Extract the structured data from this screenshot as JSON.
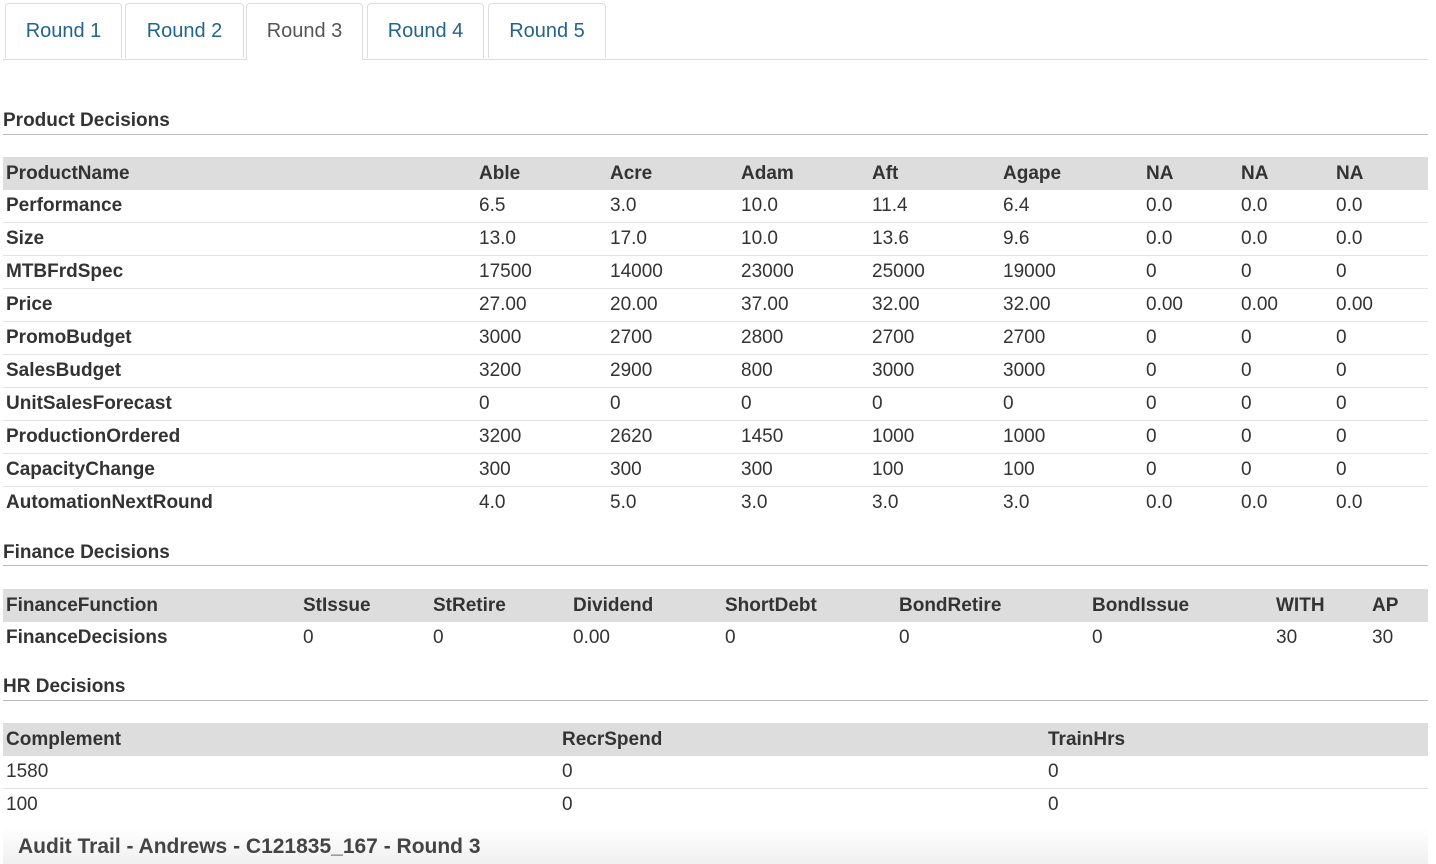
{
  "tabs": [
    "Round 1",
    "Round 2",
    "Round 3",
    "Round 4",
    "Round 5"
  ],
  "active_tab": "Round 3",
  "product": {
    "title": "Product Decisions",
    "headers": [
      "ProductName",
      "Able",
      "Acre",
      "Adam",
      "Aft",
      "Agape",
      "NA",
      "NA",
      "NA"
    ],
    "rows": [
      [
        "Performance",
        "6.5",
        "3.0",
        "10.0",
        "11.4",
        "6.4",
        "0.0",
        "0.0",
        "0.0"
      ],
      [
        "Size",
        "13.0",
        "17.0",
        "10.0",
        "13.6",
        "9.6",
        "0.0",
        "0.0",
        "0.0"
      ],
      [
        "MTBFrdSpec",
        "17500",
        "14000",
        "23000",
        "25000",
        "19000",
        "0",
        "0",
        "0"
      ],
      [
        "Price",
        "27.00",
        "20.00",
        "37.00",
        "32.00",
        "32.00",
        "0.00",
        "0.00",
        "0.00"
      ],
      [
        "PromoBudget",
        "3000",
        "2700",
        "2800",
        "2700",
        "2700",
        "0",
        "0",
        "0"
      ],
      [
        "SalesBudget",
        "3200",
        "2900",
        "800",
        "3000",
        "3000",
        "0",
        "0",
        "0"
      ],
      [
        "UnitSalesForecast",
        "0",
        "0",
        "0",
        "0",
        "0",
        "0",
        "0",
        "0"
      ],
      [
        "ProductionOrdered",
        "3200",
        "2620",
        "1450",
        "1000",
        "1000",
        "0",
        "0",
        "0"
      ],
      [
        "CapacityChange",
        "300",
        "300",
        "300",
        "100",
        "100",
        "0",
        "0",
        "0"
      ],
      [
        "AutomationNextRound",
        "4.0",
        "5.0",
        "3.0",
        "3.0",
        "3.0",
        "0.0",
        "0.0",
        "0.0"
      ]
    ]
  },
  "finance": {
    "title": "Finance Decisions",
    "headers": [
      "FinanceFunction",
      "StIssue",
      "StRetire",
      "Dividend",
      "ShortDebt",
      "BondRetire",
      "BondIssue",
      "WITH",
      "AP"
    ],
    "rows": [
      [
        "FinanceDecisions",
        "0",
        "0",
        "0.00",
        "0",
        "0",
        "0",
        "30",
        "30"
      ]
    ]
  },
  "hr": {
    "title": "HR Decisions",
    "headers": [
      "Complement",
      "RecrSpend",
      "TrainHrs"
    ],
    "rows": [
      [
        "1580",
        "0",
        "0"
      ],
      [
        "100",
        "0",
        "0"
      ]
    ]
  },
  "audit_title": "Audit Trail - Andrews - C121835_167 - Round 3"
}
